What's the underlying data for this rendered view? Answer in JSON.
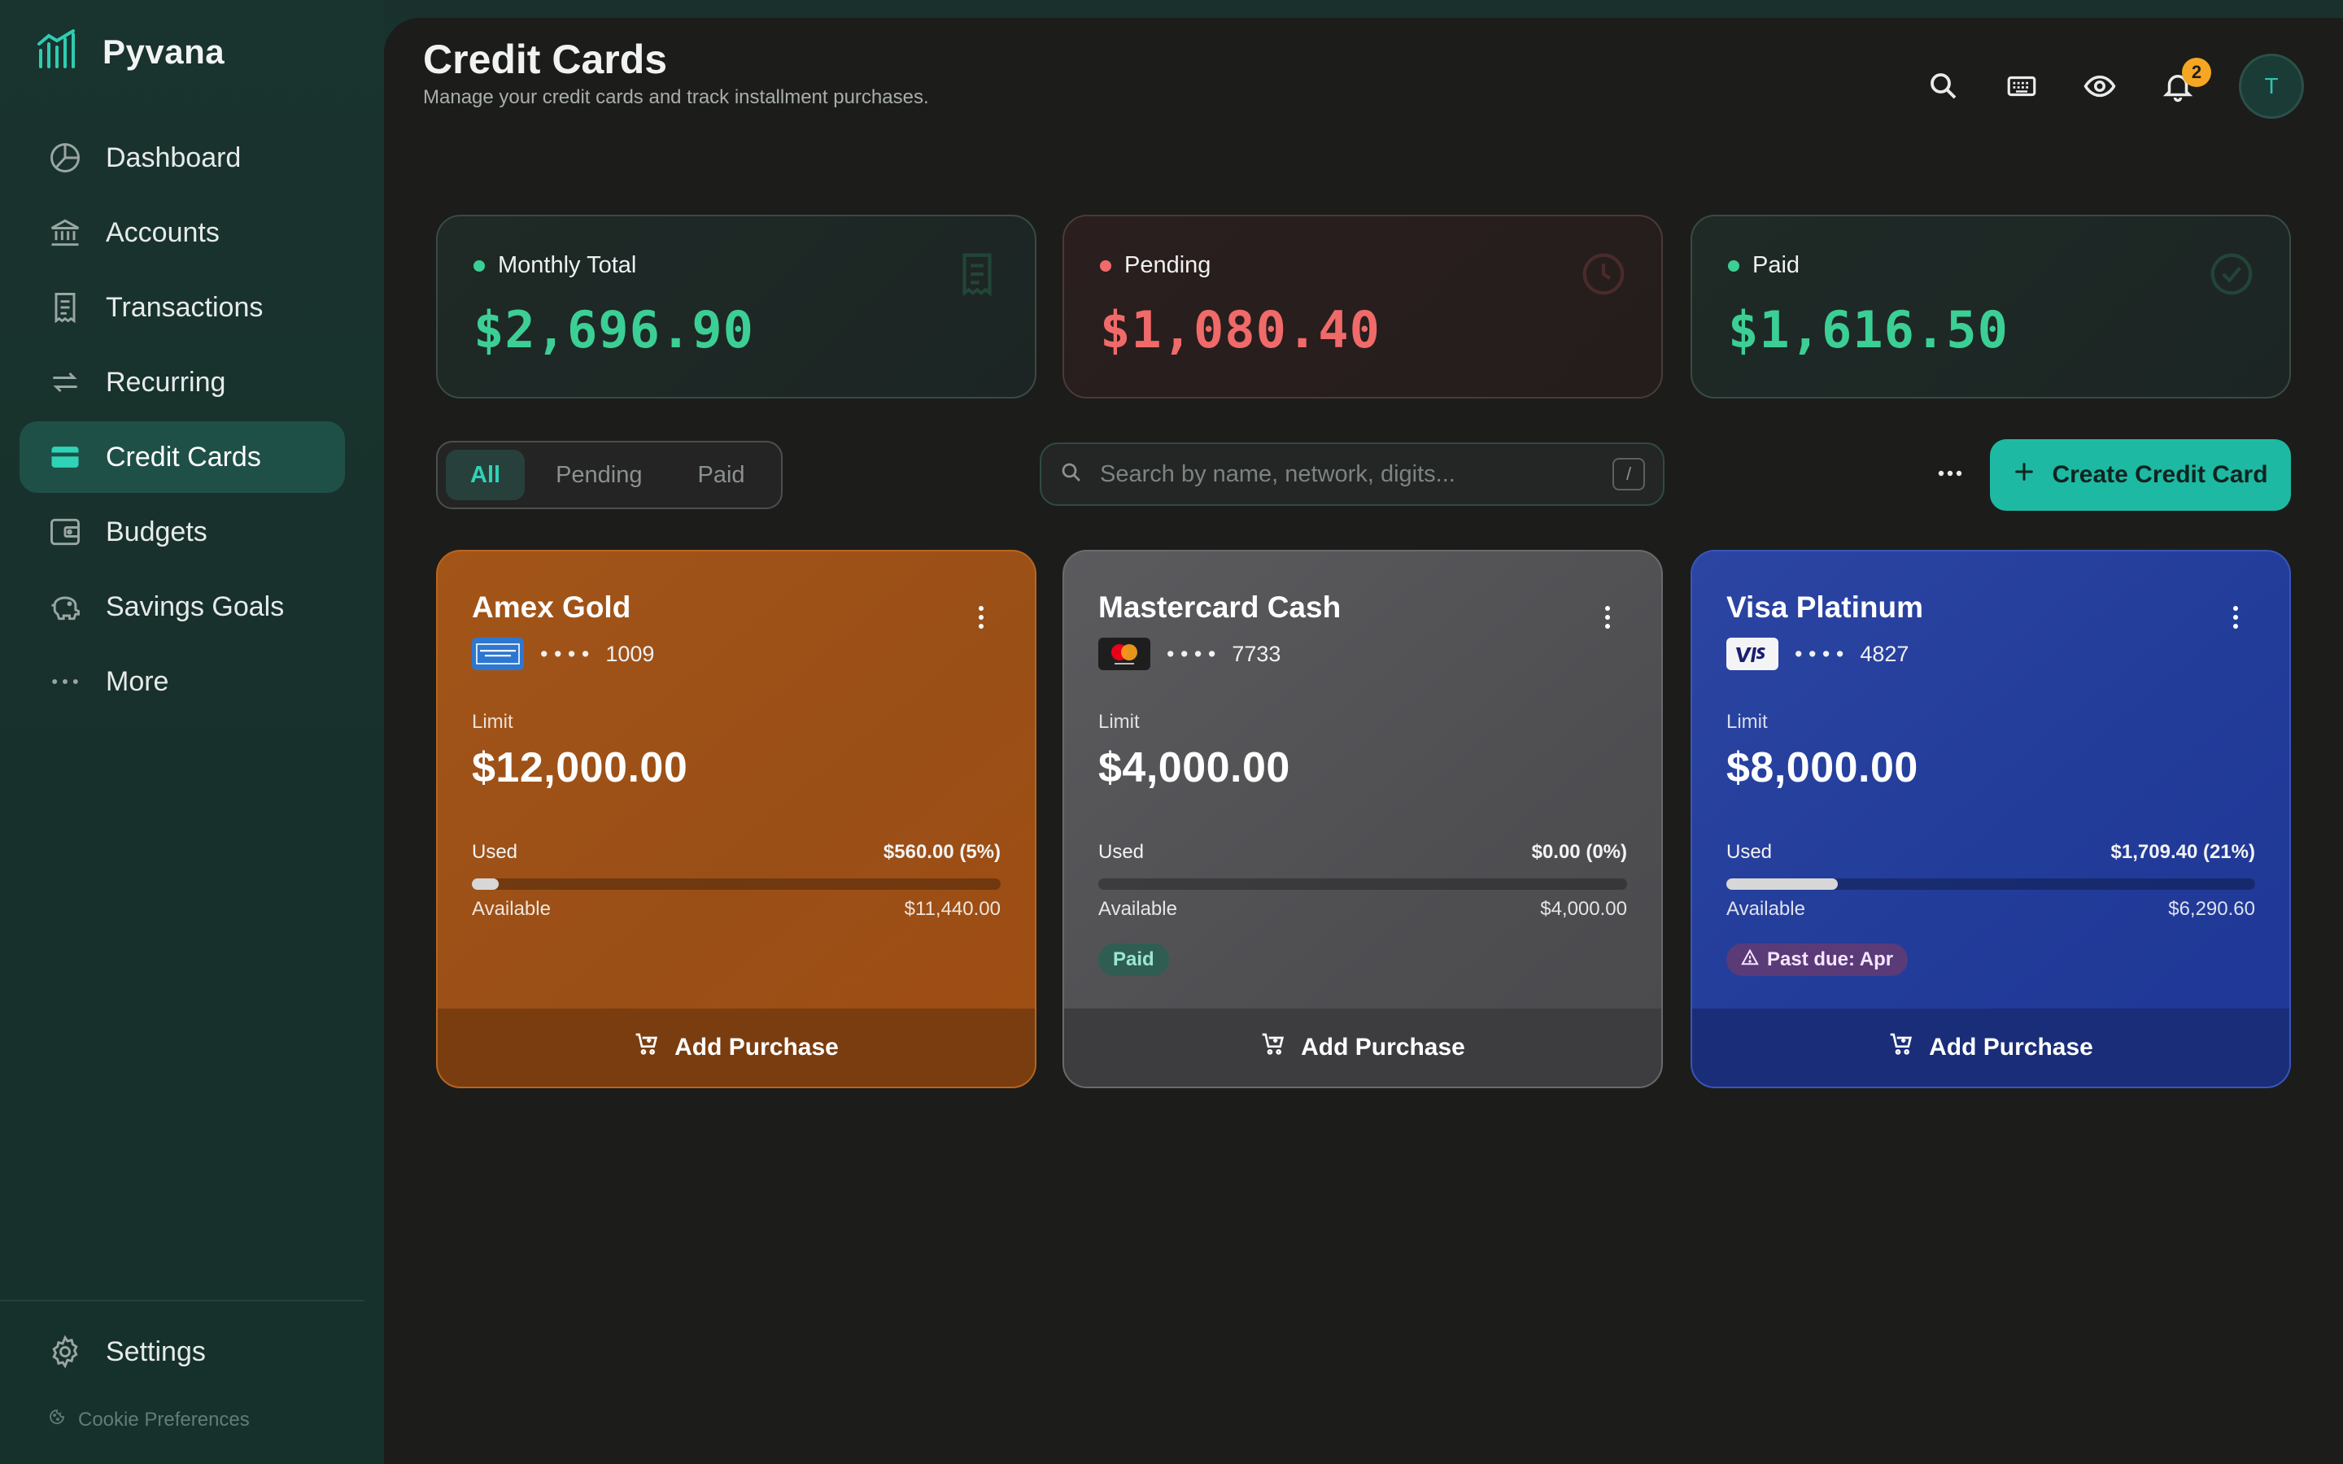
{
  "brand": {
    "name": "Pyvana"
  },
  "sidebar": {
    "items": [
      {
        "label": "Dashboard",
        "icon": "pie-chart-icon",
        "active": false
      },
      {
        "label": "Accounts",
        "icon": "bank-icon",
        "active": false
      },
      {
        "label": "Transactions",
        "icon": "receipt-icon",
        "active": false
      },
      {
        "label": "Recurring",
        "icon": "repeat-icon",
        "active": false
      },
      {
        "label": "Credit Cards",
        "icon": "credit-card-icon",
        "active": true
      },
      {
        "label": "Budgets",
        "icon": "wallet-icon",
        "active": false
      },
      {
        "label": "Savings Goals",
        "icon": "piggy-bank-icon",
        "active": false
      },
      {
        "label": "More",
        "icon": "more-horizontal-icon",
        "active": false
      }
    ],
    "settings_label": "Settings",
    "cookie_label": "Cookie Preferences"
  },
  "header": {
    "title": "Credit Cards",
    "subtitle": "Manage your credit cards and track installment purchases.",
    "notification_count": "2",
    "avatar_initial": "T"
  },
  "stats": [
    {
      "label": "Monthly Total",
      "value": "$2,696.90",
      "color": "#3ccf95",
      "icon": "receipt-icon"
    },
    {
      "label": "Pending",
      "value": "$1,080.40",
      "color": "#f06a6a",
      "icon": "clock-icon"
    },
    {
      "label": "Paid",
      "value": "$1,616.50",
      "color": "#3ccf95",
      "icon": "check-circle-icon"
    }
  ],
  "filters": {
    "tabs": [
      "All",
      "Pending",
      "Paid"
    ],
    "active": "All",
    "search_placeholder": "Search by name, network, digits...",
    "search_shortcut": "/",
    "create_label": "Create Credit Card"
  },
  "cards": [
    {
      "name": "Amex Gold",
      "network": "amex",
      "logo_text": "AMERICAN EXPRESS",
      "dots": "• • • •",
      "last4": "1009",
      "limit_label": "Limit",
      "limit": "$12,000.00",
      "used_label": "Used",
      "used": "$560.00 (5%)",
      "used_fraction": 0.05,
      "available_label": "Available",
      "available": "$11,440.00",
      "badge": "",
      "add_label": "Add Purchase"
    },
    {
      "name": "Mastercard Cash",
      "network": "mastercard",
      "logo_text": "mastercard",
      "dots": "• • • •",
      "last4": "7733",
      "limit_label": "Limit",
      "limit": "$4,000.00",
      "used_label": "Used",
      "used": "$0.00 (0%)",
      "used_fraction": 0.0,
      "available_label": "Available",
      "available": "$4,000.00",
      "badge": "Paid",
      "add_label": "Add Purchase"
    },
    {
      "name": "Visa Platinum",
      "network": "visa",
      "logo_text": "VISA",
      "dots": "• • • •",
      "last4": "4827",
      "limit_label": "Limit",
      "limit": "$8,000.00",
      "used_label": "Used",
      "used": "$1,709.40 (21%)",
      "used_fraction": 0.21,
      "available_label": "Available",
      "available": "$6,290.60",
      "badge": "Past due: Apr",
      "add_label": "Add Purchase"
    }
  ],
  "colors": {
    "accent": "#1eb9a2",
    "sidebar_bg": "#19332e",
    "main_bg": "#1c1c1b",
    "amex": "#a35518",
    "mastercard": "#55555a",
    "visa": "#2741a0"
  }
}
